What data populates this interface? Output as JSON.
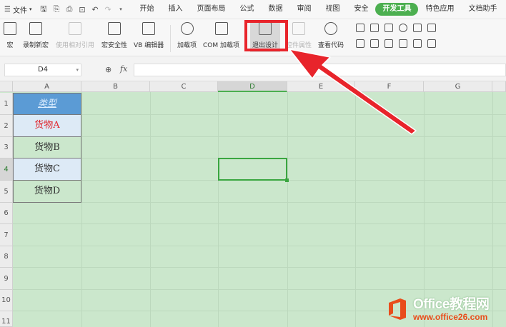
{
  "menubar": {
    "file_label": "文件",
    "tabs": [
      {
        "label": "开始",
        "active": false
      },
      {
        "label": "插入",
        "active": false
      },
      {
        "label": "页面布局",
        "active": false
      },
      {
        "label": "公式",
        "active": false
      },
      {
        "label": "数据",
        "active": false
      },
      {
        "label": "审阅",
        "active": false
      },
      {
        "label": "视图",
        "active": false
      },
      {
        "label": "安全",
        "active": false
      },
      {
        "label": "开发工具",
        "active": true
      },
      {
        "label": "特色应用",
        "active": false
      },
      {
        "label": "文档助手",
        "active": false
      }
    ]
  },
  "ribbon": {
    "macro": "宏",
    "record_macro": "录制新宏",
    "relative_ref": "使用相对引用",
    "macro_security": "宏安全性",
    "vb_editor": "VB 编辑器",
    "addins": "加载项",
    "com_addins": "COM 加载项",
    "exit_design": "退出设计",
    "control_props": "控件属性",
    "view_code": "查看代码"
  },
  "formula_bar": {
    "name_box": "D4",
    "fx_label": "fx",
    "formula": ""
  },
  "sheet": {
    "columns": [
      "A",
      "B",
      "C",
      "D",
      "E",
      "F",
      "G"
    ],
    "selected_column": "D",
    "rows": [
      "1",
      "2",
      "3",
      "4",
      "5",
      "6",
      "7",
      "8",
      "9",
      "10",
      "11"
    ],
    "selected_row": "4",
    "column_a": [
      {
        "value": "类型",
        "style": "header"
      },
      {
        "value": "货物A",
        "style": "light-red"
      },
      {
        "value": "货物B",
        "style": "plain"
      },
      {
        "value": "货物C",
        "style": "light"
      },
      {
        "value": "货物D",
        "style": "plain"
      }
    ]
  },
  "colors": {
    "accent_green": "#4caf50",
    "highlight_red": "#e8242b",
    "sheet_bg": "#cbe7cc",
    "header_blue": "#5b9bd5",
    "text_red": "#e0282f"
  },
  "watermark": {
    "brand": "Office教程网",
    "url": "www.office26.com"
  }
}
